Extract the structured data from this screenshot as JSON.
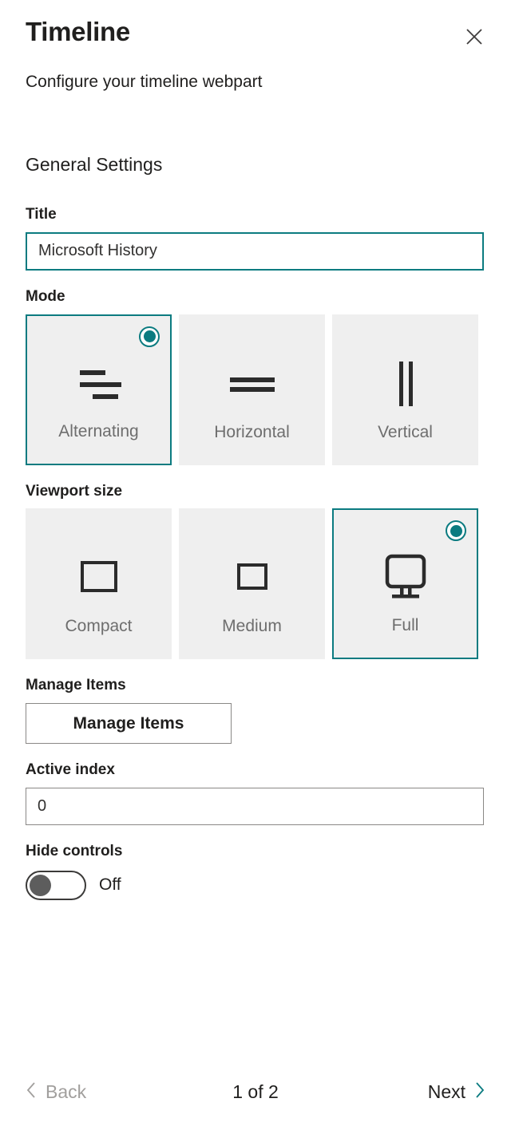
{
  "header": {
    "title": "Timeline",
    "subtitle": "Configure your timeline webpart",
    "close_icon": "close-icon"
  },
  "section": {
    "heading": "General Settings"
  },
  "title_field": {
    "label": "Title",
    "value": "Microsoft History",
    "placeholder": "Title"
  },
  "mode": {
    "label": "Mode",
    "selected": "Alternating",
    "options": [
      {
        "label": "Alternating",
        "icon": "alternating-lines-icon",
        "selected": true
      },
      {
        "label": "Horizontal",
        "icon": "horizontal-lines-icon",
        "selected": false
      },
      {
        "label": "Vertical",
        "icon": "vertical-lines-icon",
        "selected": false
      }
    ]
  },
  "viewport": {
    "label": "Viewport size",
    "selected": "Full",
    "options": [
      {
        "label": "Compact",
        "icon": "rectangle-large-icon",
        "selected": false
      },
      {
        "label": "Medium",
        "icon": "rectangle-small-icon",
        "selected": false
      },
      {
        "label": "Full",
        "icon": "monitor-icon",
        "selected": true
      }
    ]
  },
  "manage_items": {
    "label": "Manage Items",
    "button_label": "Manage Items"
  },
  "active_index": {
    "label": "Active index",
    "value": "0",
    "placeholder": "0"
  },
  "hide_controls": {
    "label": "Hide controls",
    "state": "Off",
    "checked": false
  },
  "footer": {
    "back_label": "Back",
    "next_label": "Next",
    "page_indicator": "1 of 2",
    "back_icon": "chevron-left-icon",
    "next_icon": "chevron-right-icon"
  },
  "colors": {
    "accent": "#0b7b80",
    "tile_background": "#efefef",
    "text": "#201f1e",
    "muted_text": "#6e6e6e",
    "disabled_text": "#a19f9d"
  }
}
